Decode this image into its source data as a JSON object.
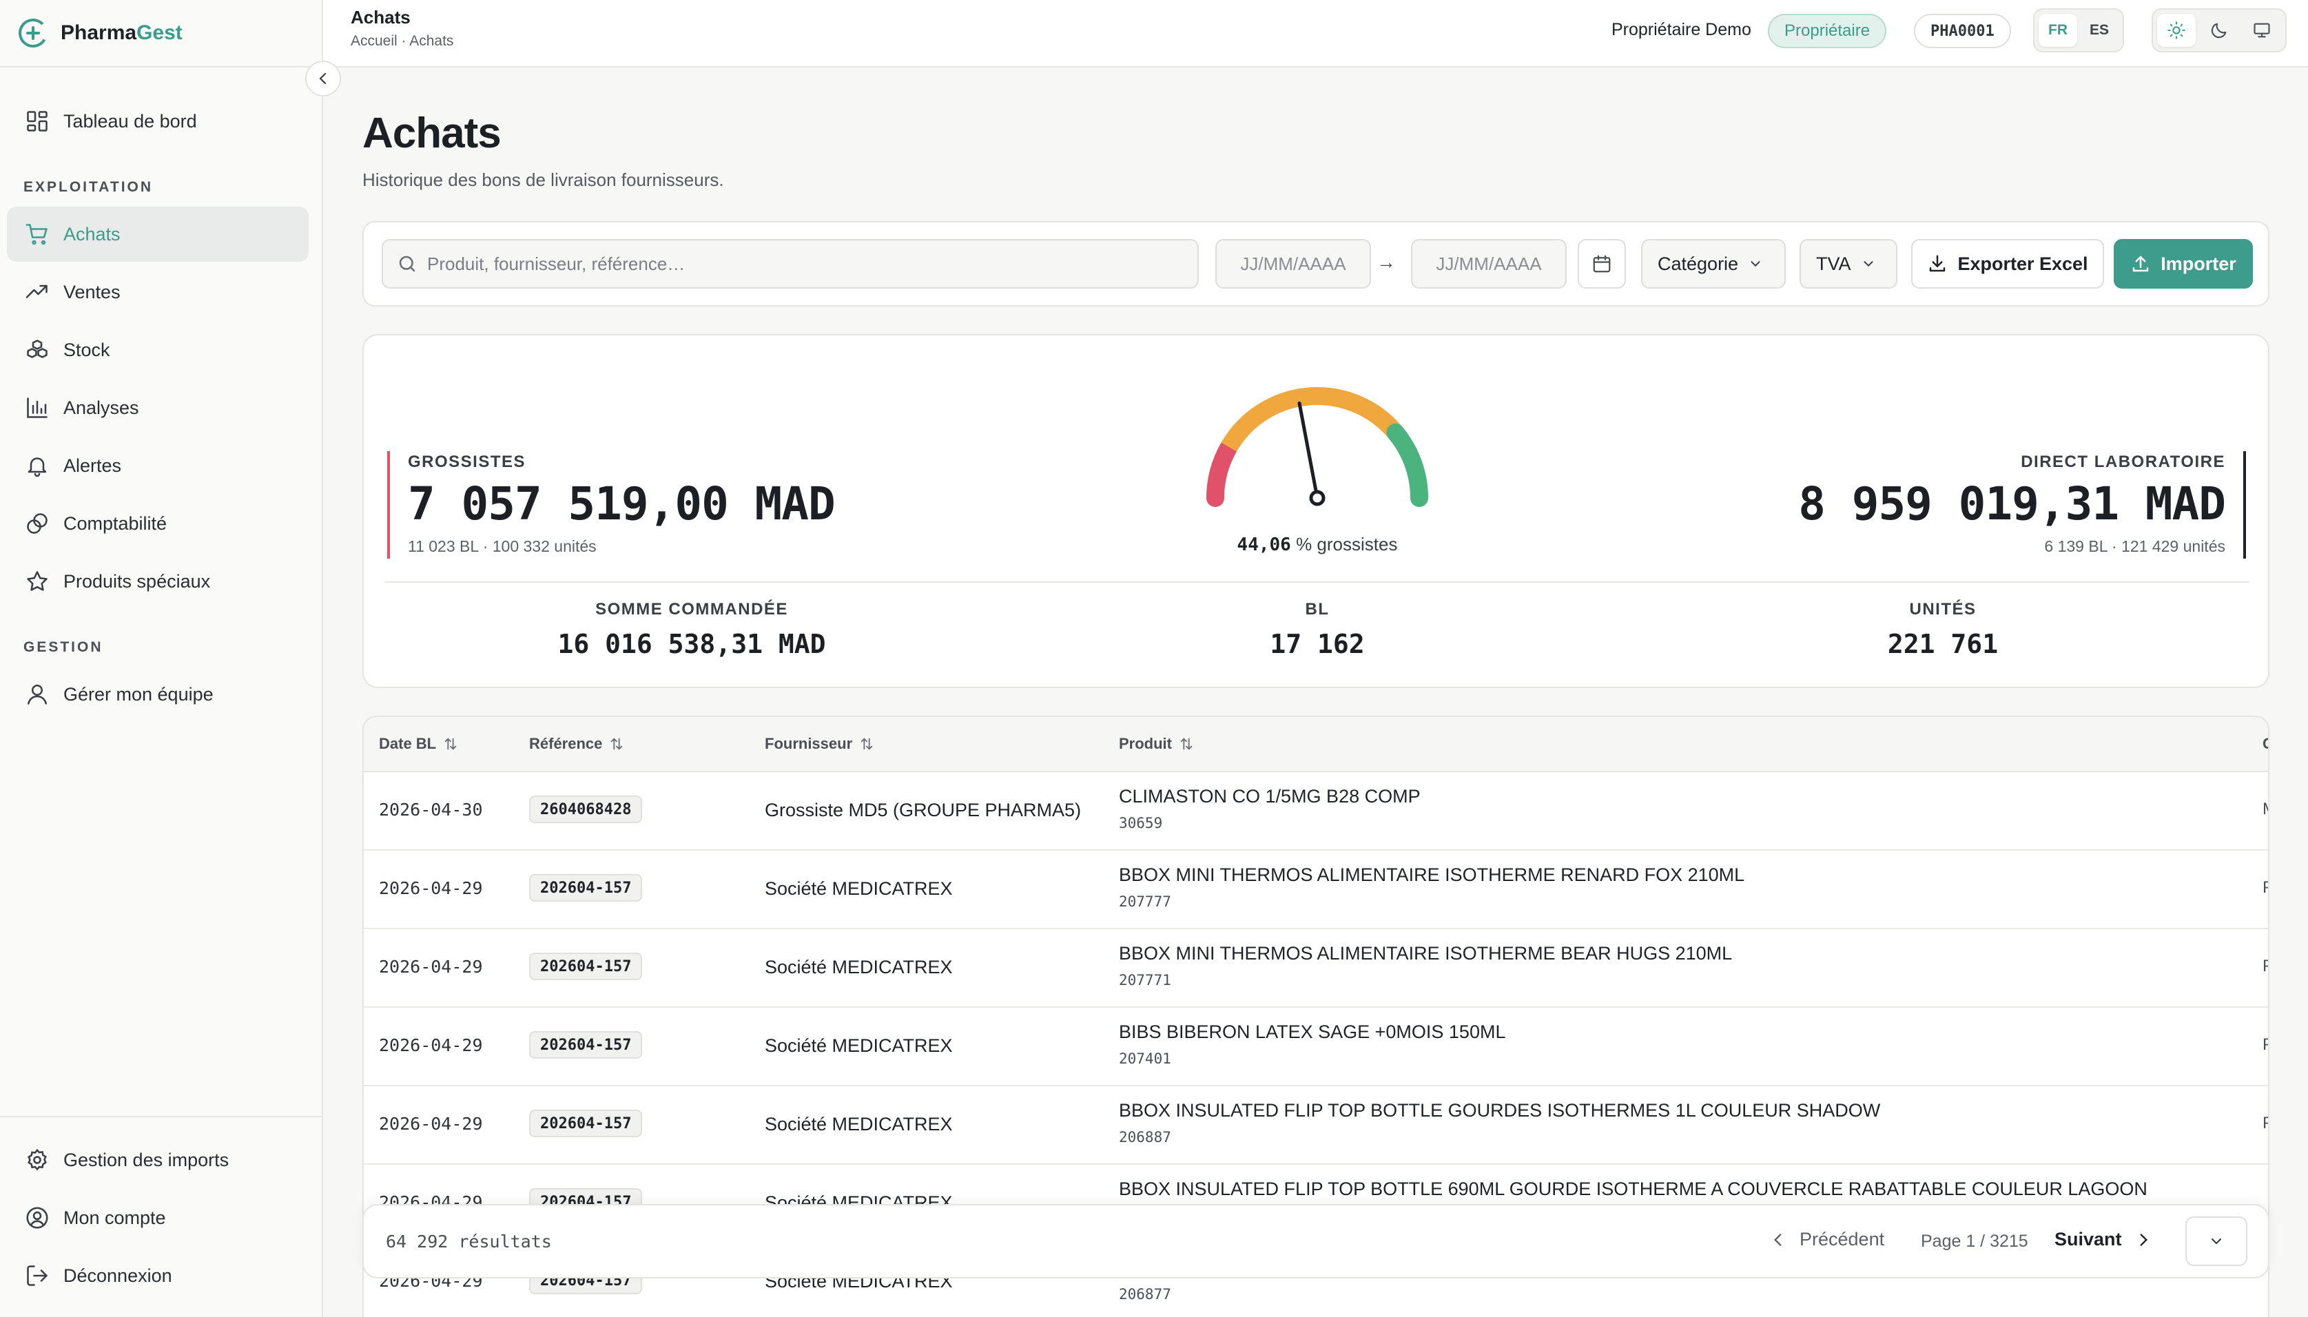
{
  "app": {
    "name_prefix": "Pharma",
    "name_suffix": "Gest"
  },
  "header": {
    "title": "Achats",
    "breadcrumb": "Accueil · Achats",
    "user_name": "Propriétaire Demo",
    "role": "Propriétaire",
    "pharmacy_code": "PHA0001",
    "languages": [
      "FR",
      "ES"
    ],
    "active_language": "FR",
    "theme_options": [
      "sun-icon",
      "moon-icon",
      "monitor-icon"
    ]
  },
  "sidebar": {
    "top_items": [
      {
        "label": "Tableau de bord",
        "icon": "dashboard-icon"
      }
    ],
    "sections": [
      {
        "label": "EXPLOITATION",
        "items": [
          {
            "label": "Achats",
            "icon": "cart-icon",
            "active": true
          },
          {
            "label": "Ventes",
            "icon": "trend-up-icon"
          },
          {
            "label": "Stock",
            "icon": "boxes-icon"
          },
          {
            "label": "Analyses",
            "icon": "bar-chart-icon"
          },
          {
            "label": "Alertes",
            "icon": "bell-icon"
          },
          {
            "label": "Comptabilité",
            "icon": "coins-icon"
          },
          {
            "label": "Produits spéciaux",
            "icon": "star-icon"
          }
        ]
      },
      {
        "label": "GESTION",
        "items": [
          {
            "label": "Gérer mon équipe",
            "icon": "user-icon"
          }
        ]
      }
    ],
    "bottom_items": [
      {
        "label": "Gestion des imports",
        "icon": "gear-icon"
      },
      {
        "label": "Mon compte",
        "icon": "account-icon"
      },
      {
        "label": "Déconnexion",
        "icon": "logout-icon"
      }
    ]
  },
  "page": {
    "title": "Achats",
    "subtitle": "Historique des bons de livraison fournisseurs."
  },
  "filters": {
    "search_placeholder": "Produit, fournisseur, référence…",
    "search_value": "",
    "date_from_placeholder": "JJ/MM/AAAA",
    "date_to_placeholder": "JJ/MM/AAAA",
    "category_label": "Catégorie",
    "tva_label": "TVA",
    "export_label": "Exporter Excel",
    "import_label": "Importer"
  },
  "stats": {
    "grossistes": {
      "label": "GROSSISTES",
      "value": "7 057 519,00 MAD",
      "meta": "11 023 BL · 100 332 unités",
      "color": "#e0526a"
    },
    "direct": {
      "label": "DIRECT LABORATOIRE",
      "value": "8 959 019,31 MAD",
      "meta": "6 139 BL · 121 429 unités"
    },
    "gauge": {
      "percent_text": "44,06",
      "suffix": "% grossistes",
      "percent": 44.06,
      "colors": [
        "#e0526a",
        "#f0a83e",
        "#4bb37e"
      ]
    },
    "totals": [
      {
        "label": "SOMME COMMANDÉE",
        "value": "16 016 538,31 MAD"
      },
      {
        "label": "BL",
        "value": "17 162"
      },
      {
        "label": "UNITÉS",
        "value": "221 761"
      }
    ]
  },
  "table": {
    "columns": [
      "Date BL",
      "Référence",
      "Fournisseur",
      "Produit"
    ],
    "truncated_column_initial": "C",
    "rows": [
      {
        "date": "2026-04-30",
        "ref": "2604068428",
        "supplier": "Grossiste MD5 (GROUPE PHARMA5)",
        "product": "CLIMASTON CO 1/5MG B28 COMP",
        "code": "30659",
        "extra": "M"
      },
      {
        "date": "2026-04-29",
        "ref": "202604-157",
        "supplier": "Société MEDICATREX",
        "product": "BBOX MINI THERMOS ALIMENTAIRE ISOTHERME RENARD FOX 210ML",
        "code": "207777",
        "extra": "P"
      },
      {
        "date": "2026-04-29",
        "ref": "202604-157",
        "supplier": "Société MEDICATREX",
        "product": "BBOX MINI THERMOS ALIMENTAIRE ISOTHERME BEAR HUGS 210ML",
        "code": "207771",
        "extra": "P"
      },
      {
        "date": "2026-04-29",
        "ref": "202604-157",
        "supplier": "Société MEDICATREX",
        "product": "BIBS BIBERON LATEX SAGE +0MOIS 150ML",
        "code": "207401",
        "extra": "P"
      },
      {
        "date": "2026-04-29",
        "ref": "202604-157",
        "supplier": "Société MEDICATREX",
        "product": "BBOX INSULATED FLIP TOP BOTTLE GOURDES ISOTHERMES 1L COULEUR SHADOW",
        "code": "206887",
        "extra": "P"
      },
      {
        "date": "2026-04-29",
        "ref": "202604-157",
        "supplier": "Société MEDICATREX",
        "product": "BBOX INSULATED FLIP TOP BOTTLE 690ML GOURDE ISOTHERME A COUVERCLE RABATTABLE COULEUR LAGOON",
        "code": "",
        "extra": ""
      },
      {
        "date": "2026-04-29",
        "ref": "202604-157",
        "supplier": "Société MEDICATREX",
        "product": "",
        "code": "206877",
        "extra": ""
      }
    ]
  },
  "pagination": {
    "count": "64 292 résultats",
    "prev_label": "Précédent",
    "page_label": "Page 1 / 3215",
    "next_label": "Suivant"
  },
  "colors": {
    "accent": "#3a9d8b",
    "import_button": "#3d9c8b"
  }
}
